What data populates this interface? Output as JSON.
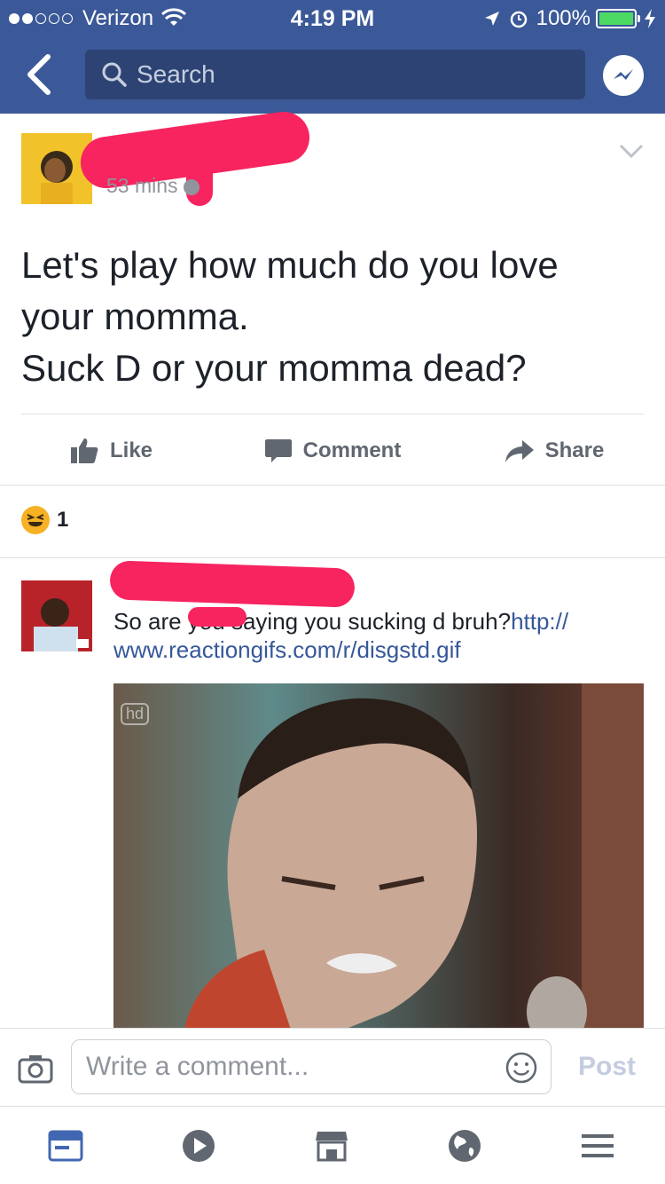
{
  "status_bar": {
    "carrier": "Verizon",
    "time": "4:19 PM",
    "battery": "100%"
  },
  "header": {
    "search_placeholder": "Search"
  },
  "post": {
    "time": "53 mins",
    "text_lines": [
      "Let's play how much do you love",
      "your momma.",
      "Suck D or your momma dead?"
    ],
    "actions": {
      "like": "Like",
      "comment": "Comment",
      "share": "Share"
    },
    "reaction_count": "1"
  },
  "comment": {
    "text_prefix": "So are you saying you sucking d bruh?",
    "link_part1": "http://",
    "link_part2": "www.reactiongifs.com/r/disgstd.gif",
    "gif_watermark": "hd"
  },
  "composer": {
    "placeholder": "Write a comment...",
    "post_label": "Post"
  },
  "colors": {
    "brand": "#3b5998",
    "redaction": "#f7245f",
    "link": "#365899"
  }
}
